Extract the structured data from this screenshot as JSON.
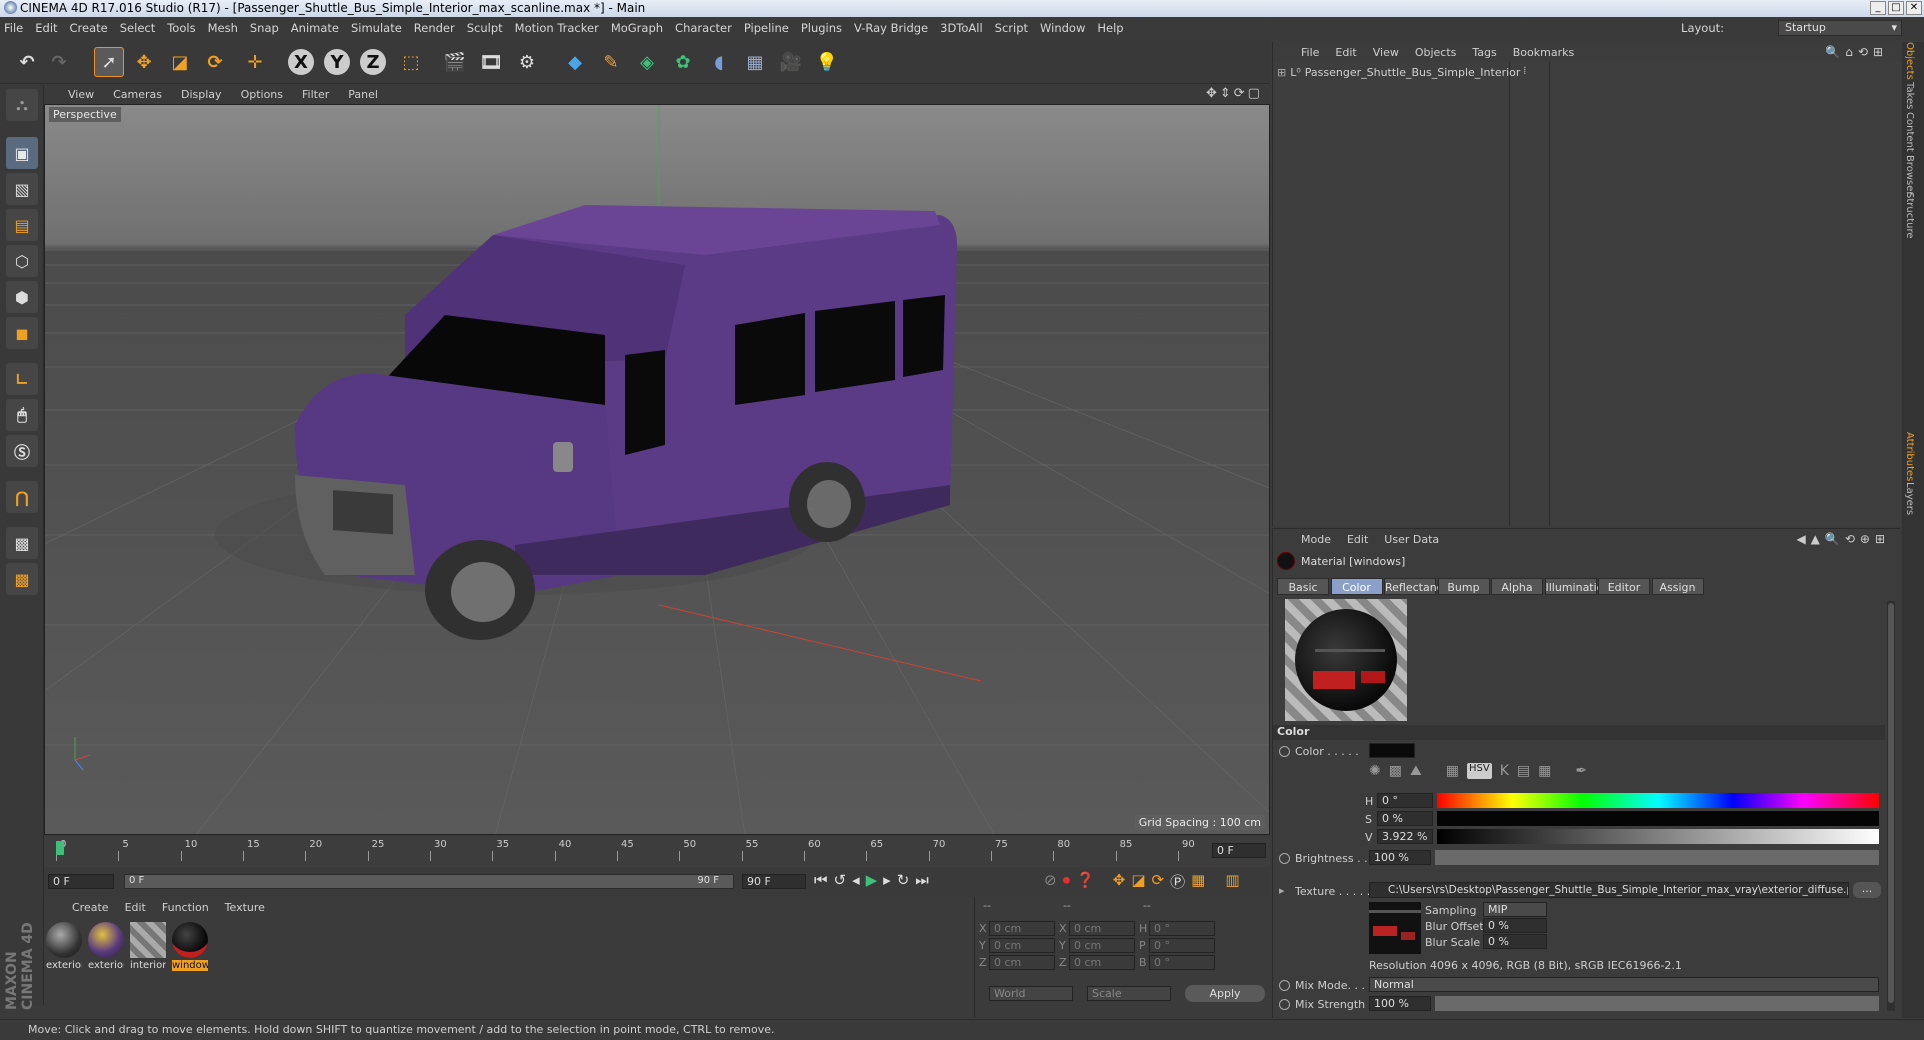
{
  "window": {
    "title": "CINEMA 4D R17.016 Studio (R17) - [Passenger_Shuttle_Bus_Simple_Interior_max_scanline.max *] - Main",
    "buttons": [
      "_",
      "□",
      "✕"
    ]
  },
  "menubar": {
    "items": [
      "File",
      "Edit",
      "Create",
      "Select",
      "Tools",
      "Mesh",
      "Snap",
      "Animate",
      "Simulate",
      "Render",
      "Sculpt",
      "Motion Tracker",
      "MoGraph",
      "Character",
      "Pipeline",
      "Plugins",
      "V-Ray Bridge",
      "3DToAll",
      "Script",
      "Window",
      "Help"
    ],
    "layout_label": "Layout:",
    "layout_value": "Startup"
  },
  "viewport": {
    "menu": [
      "View",
      "Cameras",
      "Display",
      "Options",
      "Filter",
      "Panel"
    ],
    "label": "Perspective",
    "grid_spacing": "Grid Spacing : 100 cm"
  },
  "timeline": {
    "ticks": [
      "0",
      "5",
      "10",
      "15",
      "20",
      "25",
      "30",
      "35",
      "40",
      "45",
      "50",
      "55",
      "60",
      "65",
      "70",
      "75",
      "80",
      "85",
      "90"
    ],
    "current_frame": "0 F",
    "start": "0 F",
    "range_start": "0 F",
    "range_end": "90 F",
    "end": "90 F"
  },
  "material_manager": {
    "menu": [
      "Create",
      "Edit",
      "Function",
      "Texture"
    ],
    "materials": [
      {
        "name": "exterior",
        "selected": false
      },
      {
        "name": "exterior_",
        "selected": false
      },
      {
        "name": "interior",
        "selected": false
      },
      {
        "name": "windows",
        "selected": true
      }
    ]
  },
  "coords": {
    "header": [
      "--",
      "--",
      "--"
    ],
    "rows": [
      {
        "a": "X",
        "av": "0 cm",
        "b": "X",
        "bv": "0 cm",
        "c": "H",
        "cv": "0 °"
      },
      {
        "a": "Y",
        "av": "0 cm",
        "b": "Y",
        "bv": "0 cm",
        "c": "P",
        "cv": "0 °"
      },
      {
        "a": "Z",
        "av": "0 cm",
        "b": "Z",
        "bv": "0 cm",
        "c": "B",
        "cv": "0 °"
      }
    ],
    "world": "World",
    "scale": "Scale",
    "apply": "Apply"
  },
  "object_manager": {
    "menu": [
      "File",
      "Edit",
      "View",
      "Objects",
      "Tags",
      "Bookmarks"
    ],
    "object_name": "Passenger_Shuttle_Bus_Simple_Interior"
  },
  "attributes": {
    "menu": [
      "Mode",
      "Edit",
      "User Data"
    ],
    "material_title": "Material [windows]",
    "tabs": [
      "Basic",
      "Color",
      "Reflectance",
      "Bump",
      "Alpha",
      "Illumination",
      "Editor",
      "Assign"
    ],
    "active_tab": "Color",
    "section": "Color",
    "color_label": "Color . . . . .",
    "h_label": "H",
    "h_value": "0 °",
    "s_label": "S",
    "s_value": "0 %",
    "v_label": "V",
    "v_value": "3.922 %",
    "brightness_label": "Brightness . . .",
    "brightness_value": "100 %",
    "texture_label": "Texture . . . . .",
    "texture_path": "C:\\Users\\rs\\Desktop\\Passenger_Shuttle_Bus_Simple_Interior_max_vray\\exterior_diffuse.png",
    "sampling_label": "Sampling",
    "sampling_value": "MIP",
    "blur_offset_label": "Blur Offset",
    "blur_offset_value": "0 %",
    "blur_scale_label": "Blur Scale",
    "blur_scale_value": "0 %",
    "resolution": "Resolution 4096 x 4096, RGB (8 Bit), sRGB IEC61966-2.1",
    "mix_mode_label": "Mix Mode. . . . .",
    "mix_mode_value": "Normal",
    "mix_strength_label": "Mix Strength",
    "mix_strength_value": "100 %",
    "hsv_btn": "HSV"
  },
  "right_tabs": [
    "Objects",
    "Takes",
    "Content Browser",
    "Structure",
    "Attributes",
    "Layers"
  ],
  "status": "Move: Click and drag to move elements. Hold down SHIFT to quantize movement / add to the selection in point mode, CTRL to remove.",
  "brand": "MAXON CINEMA 4D",
  "colors": {
    "bus": "#5b3a86",
    "accent": "#f0a020"
  }
}
